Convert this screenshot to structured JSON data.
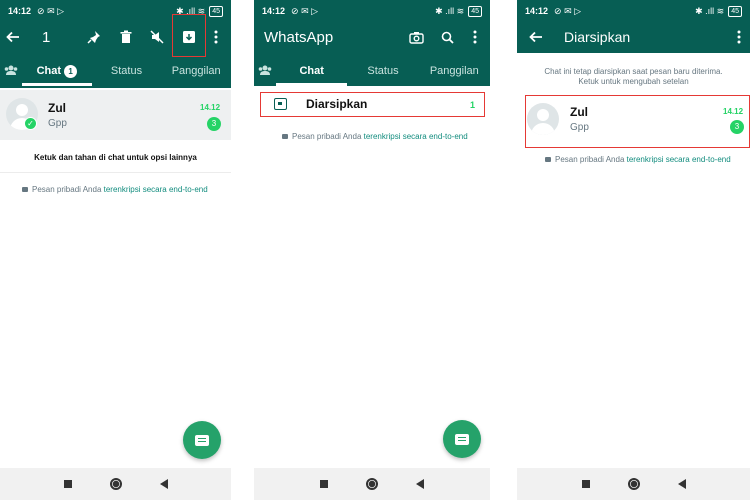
{
  "status": {
    "time": "14:12",
    "left_icons": "⊘ ✉ ▷",
    "right_icons": "✱ .ıll ≋",
    "battery": "45"
  },
  "colors": {
    "header": "#075e54",
    "accent_green": "#25d366",
    "fab": "#25a26a",
    "highlight": "#e53935"
  },
  "panel1": {
    "selected_count": "1",
    "tabs": [
      {
        "label": "Chat",
        "badge": "1"
      },
      {
        "label": "Status"
      },
      {
        "label": "Panggilan"
      }
    ],
    "chat": {
      "name": "Zul",
      "message": "Gpp",
      "time": "14.12",
      "unread": "3"
    },
    "hint": "Ketuk dan tahan di chat untuk opsi lainnya",
    "enc_text": "Pesan pribadi Anda ",
    "enc_link": "terenkripsi secara end-to-end",
    "icons": [
      "back-arrow-icon",
      "pin-icon",
      "delete-icon",
      "mute-icon",
      "archive-icon",
      "more-icon"
    ]
  },
  "panel2": {
    "title": "WhatsApp",
    "tabs": [
      {
        "label": "Chat"
      },
      {
        "label": "Status"
      },
      {
        "label": "Panggilan"
      }
    ],
    "archived_label": "Diarsipkan",
    "archived_count": "1",
    "enc_text": "Pesan pribadi Anda ",
    "enc_link": "terenkripsi secara end-to-end",
    "icons": [
      "camera-icon",
      "search-icon",
      "more-icon"
    ]
  },
  "panel3": {
    "title": "Diarsipkan",
    "notice_line1": "Chat ini tetap diarsipkan saat pesan baru diterima.",
    "notice_line2": "Ketuk untuk mengubah setelan",
    "chat": {
      "name": "Zul",
      "message": "Gpp",
      "time": "14.12",
      "unread": "3"
    },
    "enc_text": "Pesan pribadi Anda ",
    "enc_link": "terenkripsi secara end-to-end"
  }
}
